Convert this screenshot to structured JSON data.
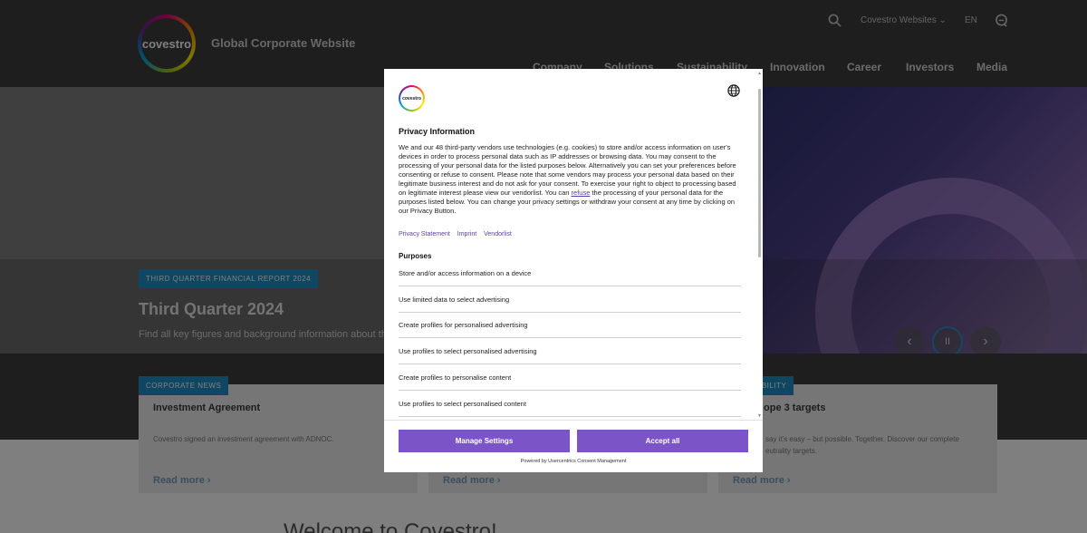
{
  "header": {
    "logo_text": "covestro",
    "site_title": "Global Corporate Website",
    "websites_label": "Covestro Websites",
    "language": "EN",
    "nav": [
      "Company",
      "Solutions",
      "Sustainability",
      "Innovation",
      "Career",
      "Investors",
      "Media"
    ]
  },
  "hero": {
    "badge": "THIRD QUARTER FINANCIAL REPORT 2024",
    "title": "Third Quarter 2024",
    "subtitle": "Find all key figures and background information about the",
    "controls": {
      "prev": "‹",
      "pause": "II",
      "next": "›"
    }
  },
  "cards": [
    {
      "tag": "CORPORATE NEWS",
      "title": "Investment Agreement",
      "text": "Covestro signed an investment agreement with ADNOC.",
      "link": "Read more"
    },
    {
      "tag": "",
      "title": "",
      "text": "",
      "link": "Read more"
    },
    {
      "tag": "ABILITY",
      "title": "ope 3 targets",
      "text": "say it's easy – but possible. Together. Discover our complete",
      "text2": "eutrality targets.",
      "link": "Read more"
    }
  ],
  "welcome": "Welcome to Covestro!",
  "dialog": {
    "logo_text": "covestro",
    "heading": "Privacy Information",
    "body_before": "We and our 48 third-party vendors use technologies (e.g. cookies) to store and/or access information on user's devices in order to process personal data such as IP addresses or browsing data. You may consent to the processing of your personal data for the listed purposes below. Alternatively you can set your preferences before consenting or refuse to consent. Please note that some vendors may process your personal data based on their legitimate business interest and do not ask for your consent. To exercise your right to object to processing based on legitimate interest please view our vendorlist. You can ",
    "body_link": "refuse",
    "body_after": " the processing of your personal data for the purposes listed below. You can change your privacy settings or withdraw your consent at any time by clicking on our Privacy Button.",
    "links": [
      "Privacy Statement",
      "Imprint",
      "Vendorlist"
    ],
    "purposes_heading": "Purposes",
    "purposes": [
      "Store and/or access information on a device",
      "Use limited data to select advertising",
      "Create profiles for personalised advertising",
      "Use profiles to select personalised advertising",
      "Create profiles to personalise content",
      "Use profiles to select personalised content"
    ],
    "manage_label": "Manage Settings",
    "accept_label": "Accept all",
    "powered_by": "Powered by Usercentrics Consent Management"
  },
  "colors": {
    "accent_purple": "#7b55c7",
    "badge_blue": "#1f8fc7",
    "header_gray": "#3d3d3d"
  }
}
